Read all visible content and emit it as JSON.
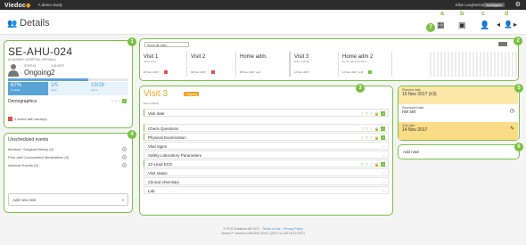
{
  "topbar": {
    "brand": "Viedoc",
    "study": "A demo study",
    "user": "Elise Leeghenhamp",
    "role": "Investigator"
  },
  "header": {
    "title": "Details",
    "letters": [
      "a",
      "b",
      "c",
      "d"
    ],
    "badge7": "7"
  },
  "subject": {
    "id": "SE-AHU-024",
    "hospital": "ACADEMIC HOSPITAL UPPSALA",
    "status_label": "STATUS",
    "status": "Ongoing",
    "cohort_label": "COHORT",
    "cohort": "2",
    "progress": 0.67,
    "stats": [
      {
        "value": "67%",
        "label": "of study"
      },
      {
        "value": "3/5",
        "label": "visits"
      },
      {
        "value": "19/28",
        "label": "forms"
      }
    ],
    "demographics": "Demographics",
    "issues": "2 forms with issue(s)"
  },
  "unscheduled": {
    "title": "Unscheduled events",
    "rows": [
      "Medical / Surgical History (0)",
      "Prior and Concomitant Medications (0)",
      "Adverse Events (0)"
    ],
    "add": "Add new visit"
  },
  "visits": {
    "select": "Show all visits",
    "items": [
      {
        "name": "Visit 1",
        "sub": "Screening",
        "date": "15 Nov 2017"
      },
      {
        "name": "Visit 2",
        "sub": "",
        "date": "09 Nov 2017"
      },
      {
        "name": "Home adm.",
        "sub": "",
        "date": "08 Nov 2017 (+4)"
      },
      {
        "name": "Visit 3",
        "sub": "End of Study",
        "date": "14 Nov 2017"
      },
      {
        "name": "Home adm 2",
        "sub": "Home administration",
        "date": "14 Nov 2017 (+3)"
      }
    ]
  },
  "visit3": {
    "title": "Visit 3",
    "status": "Ongoing",
    "subtitle": "End of Study",
    "rows": [
      "Visit date",
      "Check Questions",
      "Physical Examination",
      "Vital Signs",
      "Safety Laboratory Parameters",
      "12-Lead ECG",
      "Visit status",
      "Clinical chemistry",
      "Lab"
    ]
  },
  "dates": {
    "planned_label": "Planned date",
    "planned": "15 Nov 2017 (±3)",
    "scheduled_label": "Scheduled date",
    "scheduled": "not set",
    "visit_label": "Visit date",
    "visit": "14 Nov 2017"
  },
  "note": {
    "label": "Add note"
  },
  "footer": {
    "copy": "© PCG Solutions AB 2017 -",
    "terms": "Terms of Use",
    "privacy": "Privacy Policy",
    "version": "Viedoc™ version 4.38.6333.20047 (2017-11-20T13:12 CET)"
  }
}
